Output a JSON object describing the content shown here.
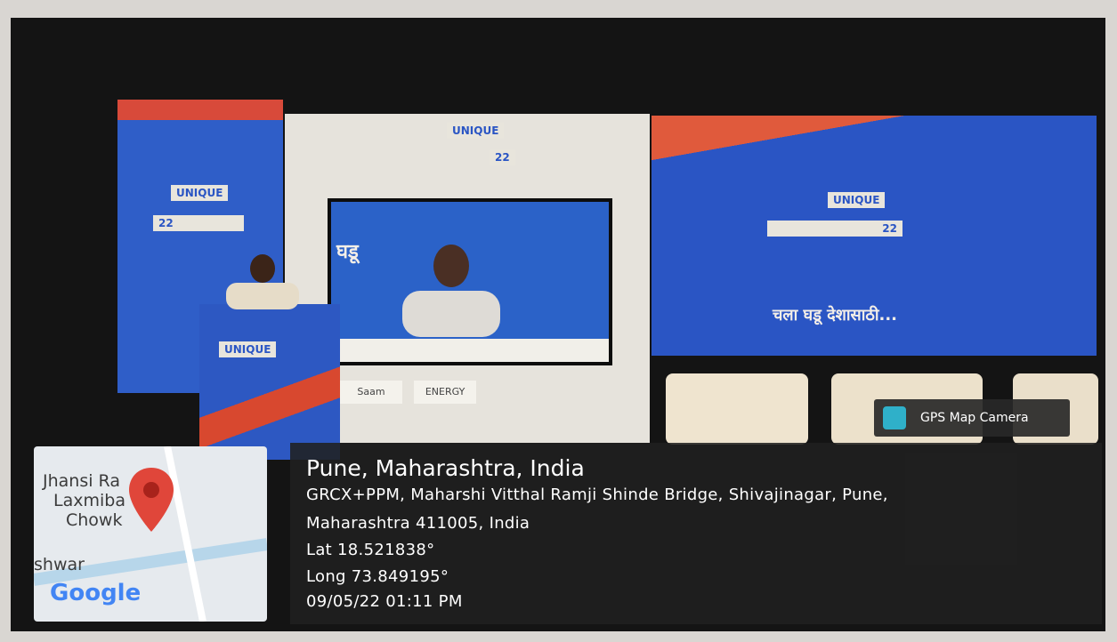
{
  "location": {
    "title": "Pune, Maharashtra, India",
    "address_line1": "GRCX+PPM, Maharshi Vitthal Ramji Shinde Bridge, Shivajinagar, Pune,",
    "address_line2": "Maharashtra 411005, India",
    "lat": "Lat 18.521838°",
    "long": "Long 73.849195°",
    "datetime": "09/05/22 01:11 PM"
  },
  "gps_badge": {
    "label": "GPS Map Camera"
  },
  "map": {
    "place1_line1": "Jhansi Ra",
    "place1_line2": "Laxmiba",
    "place1_line3": "Chowk",
    "place2_line1": "shwar",
    "brand": "Google"
  },
  "stage": {
    "brand_tag": "UNIQUE",
    "year_tag": "22",
    "slogan": "चला घडू देशासाठी...",
    "screen_text": "घडू",
    "logo1": "Saam",
    "logo2": "ENERGY"
  },
  "colors": {
    "stage_blue": "#2a55c4",
    "stage_red": "#d84a3a",
    "pin_red": "#e0463a",
    "overlay_bg": "#202020"
  }
}
